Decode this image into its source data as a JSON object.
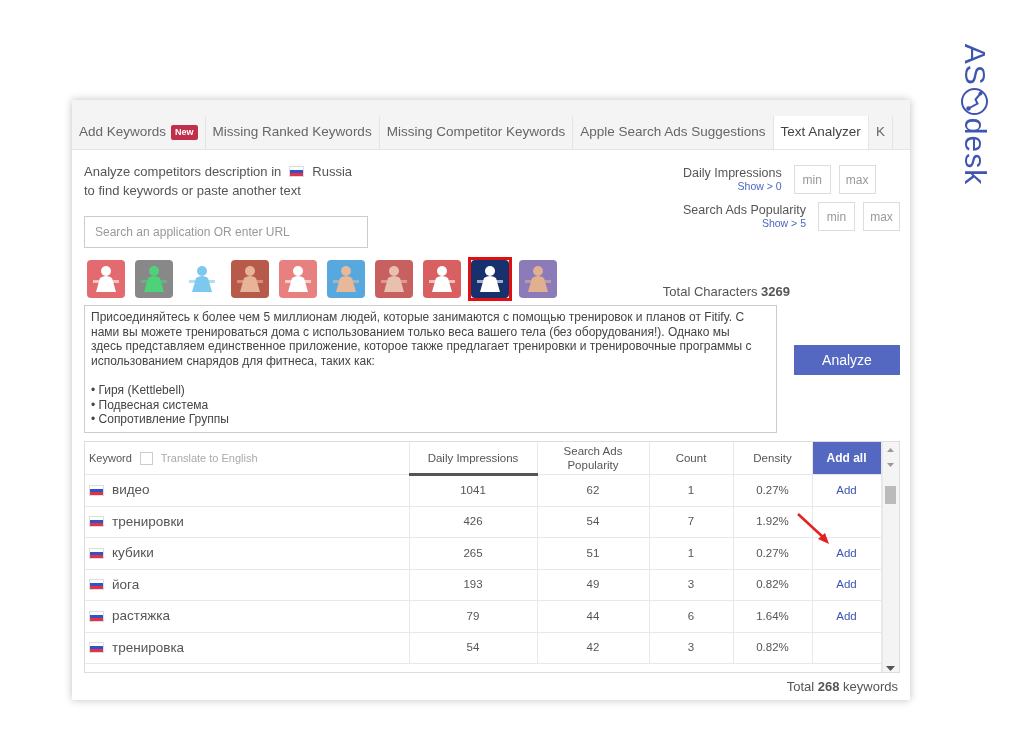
{
  "logo": {
    "prefix": "AS",
    "suffix": "desk"
  },
  "tabs": [
    {
      "label": "Add Keywords",
      "badge": "New",
      "selected": false
    },
    {
      "label": "Missing Ranked Keywords",
      "selected": false
    },
    {
      "label": "Missing Competitor Keywords",
      "selected": false
    },
    {
      "label": "Apple Search Ads Suggestions",
      "selected": false
    },
    {
      "label": "Text Analyzer",
      "selected": true
    },
    {
      "label": "K",
      "selected": false
    }
  ],
  "intro": {
    "line_1": "Analyze competitors description in",
    "country": "Russia",
    "line_2": "to find keywords or paste another text"
  },
  "filters": [
    {
      "label": "Daily Impressions",
      "hint": "Show > 0",
      "min_placeholder": "min",
      "max_placeholder": "max"
    },
    {
      "label": "Search Ads Popularity",
      "hint": "Show > 5",
      "min_placeholder": "min",
      "max_placeholder": "max"
    }
  ],
  "search": {
    "placeholder": "Search an application OR enter URL"
  },
  "apps": [
    {
      "selected": false
    },
    {
      "selected": false
    },
    {
      "selected": false
    },
    {
      "selected": false
    },
    {
      "selected": false
    },
    {
      "selected": false
    },
    {
      "selected": false
    },
    {
      "selected": false
    },
    {
      "selected": true
    },
    {
      "selected": false
    }
  ],
  "total_characters": {
    "label": "Total Characters",
    "value": "3269"
  },
  "description": "Присоединяйтесь к более чем 5 миллионам людей, которые занимаются с помощью тренировок и планов от Fitify. С нами вы можете тренироваться дома с использованием только веса вашего тела (без оборудования!). Однако мы здесь представляем единственное приложение, которое также предлагает тренировки и тренировочные программы с использованием снарядов для фитнеса, таких как:\n\n• Гиря (Kettlebell)\n• Подвесная система\n• Сопротивление Группы",
  "analyze_button": "Analyze",
  "table": {
    "keyword_column": "Keyword",
    "translate": {
      "label": "Translate to English",
      "checked": false
    },
    "columns": [
      {
        "label": "Daily Impressions",
        "sorted": true
      },
      {
        "label": "Search Ads Popularity",
        "sorted": false
      },
      {
        "label": "Count",
        "sorted": false
      },
      {
        "label": "Density",
        "sorted": false
      }
    ],
    "add_all": "Add all",
    "rows": [
      {
        "keyword": "видео",
        "impressions": "1041",
        "popularity": "62",
        "count": "1",
        "density": "0.27%",
        "add": "Add"
      },
      {
        "keyword": "тренировки",
        "impressions": "426",
        "popularity": "54",
        "count": "7",
        "density": "1.92%"
      },
      {
        "keyword": "кубики",
        "impressions": "265",
        "popularity": "51",
        "count": "1",
        "density": "0.27%",
        "add": "Add"
      },
      {
        "keyword": "йога",
        "impressions": "193",
        "popularity": "49",
        "count": "3",
        "density": "0.82%",
        "add": "Add"
      },
      {
        "keyword": "растяжка",
        "impressions": "79",
        "popularity": "44",
        "count": "6",
        "density": "1.64%",
        "add": "Add"
      },
      {
        "keyword": "тренировка",
        "impressions": "54",
        "popularity": "42",
        "count": "3",
        "density": "0.82%"
      }
    ]
  },
  "total": {
    "prefix": "Total",
    "value": "268",
    "suffix": "keywords"
  }
}
